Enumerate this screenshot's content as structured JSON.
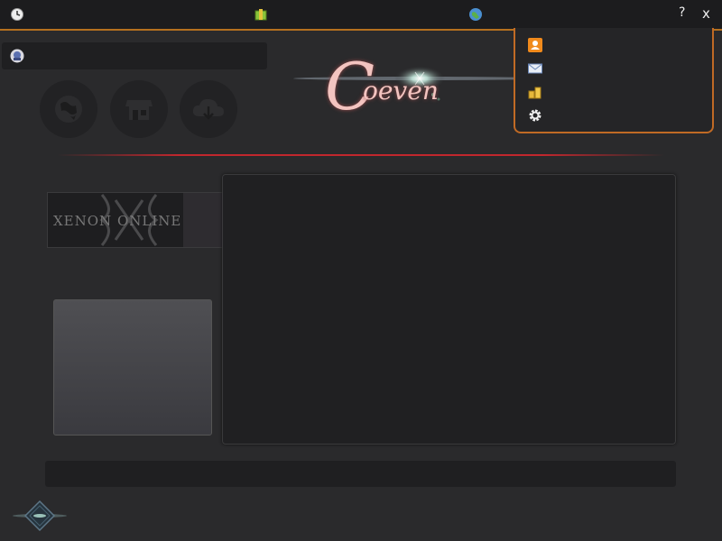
{
  "window": {
    "help_label": "?",
    "close_label": "x"
  },
  "titlebar_icons": {
    "clock": "clock-icon",
    "package": "package-icon",
    "globe": "globe-icon"
  },
  "user": {
    "name": ""
  },
  "nav_buttons": [
    {
      "icon": "globe-icon"
    },
    {
      "icon": "store-icon"
    },
    {
      "icon": "cloud-download-icon"
    }
  ],
  "logo": {
    "initial": "C",
    "text": "oeven"
  },
  "menu": {
    "items": [
      {
        "icon": "profile-icon",
        "label": ""
      },
      {
        "icon": "mail-icon",
        "label": ""
      },
      {
        "icon": "coins-icon",
        "label": ""
      },
      {
        "icon": "gear-icon",
        "label": ""
      }
    ]
  },
  "game": {
    "banner": "XENON ONLINE"
  },
  "news": {
    "content": ""
  },
  "status": {
    "text": ""
  },
  "colors": {
    "background": "#2a2a2c",
    "accent": "#c06a25",
    "divider": "#c1272d",
    "logo": "#f3c4c0"
  }
}
